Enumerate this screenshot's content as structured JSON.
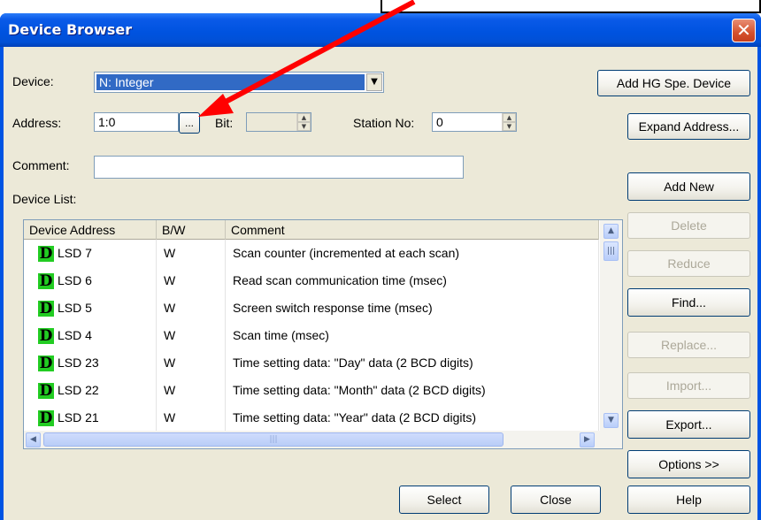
{
  "window": {
    "title": "Device Browser",
    "close_glyph": "✕"
  },
  "device": {
    "label": "Device:",
    "value": "N: Integer",
    "dropdown_glyph": "▼"
  },
  "address": {
    "label": "Address:",
    "value": "1:0",
    "browse_label": "..."
  },
  "bit": {
    "label": "Bit:",
    "value": ""
  },
  "station": {
    "label": "Station No:",
    "value": "0"
  },
  "comment": {
    "label": "Comment:",
    "value": ""
  },
  "device_list": {
    "label": "Device List:",
    "columns": [
      "Device Address",
      "B/W",
      "Comment"
    ],
    "rows": [
      {
        "icon": "D",
        "address": "LSD 7",
        "bw": "W",
        "comment": "Scan counter (incremented at each scan)"
      },
      {
        "icon": "D",
        "address": "LSD 6",
        "bw": "W",
        "comment": "Read scan communication time (msec)"
      },
      {
        "icon": "D",
        "address": "LSD 5",
        "bw": "W",
        "comment": "Screen switch response time (msec)"
      },
      {
        "icon": "D",
        "address": "LSD 4",
        "bw": "W",
        "comment": "Scan time (msec)"
      },
      {
        "icon": "D",
        "address": "LSD 23",
        "bw": "W",
        "comment": "Time setting data: \"Day\" data (2 BCD digits)"
      },
      {
        "icon": "D",
        "address": "LSD 22",
        "bw": "W",
        "comment": "Time setting data: \"Month\" data (2 BCD digits)"
      },
      {
        "icon": "D",
        "address": "LSD 21",
        "bw": "W",
        "comment": "Time setting data: \"Year\" data (2 BCD digits)"
      }
    ],
    "scroll_up": "▲",
    "scroll_down": "▼",
    "scroll_left": "◀",
    "scroll_right": "▶",
    "grip": "|||"
  },
  "buttons": {
    "add_hg": "Add HG Spe. Device",
    "expand": "Expand Address...",
    "add_new": "Add New",
    "delete": "Delete",
    "reduce": "Reduce",
    "find": "Find...",
    "replace": "Replace...",
    "import": "Import...",
    "export": "Export...",
    "options": "Options >>",
    "select": "Select",
    "close": "Close",
    "help": "Help"
  },
  "colors": {
    "title_bar": "#0054e3",
    "dialog_bg": "#ece9d8",
    "annotation_arrow": "#ff0000",
    "device_icon": "#22cc22"
  }
}
